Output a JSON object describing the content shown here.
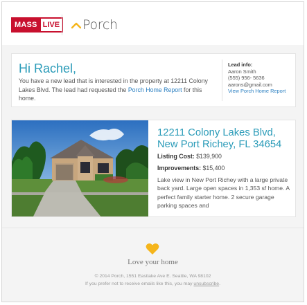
{
  "header": {
    "brand_left_1": "MASS",
    "brand_left_2": "LIVE",
    "brand_right": "Porch",
    "colors": {
      "masslive_red": "#c8102e",
      "porch_yellow": "#f5b51b"
    }
  },
  "intro": {
    "greeting": "Hi Rachel,",
    "text_before_link": "You have a new lead that is interested in the property at 12211 Colony Lakes Blvd. The lead had requested the ",
    "link_text": "Porch Home Report",
    "text_after_link": " for this home.",
    "accent_color": "#2a9bb8"
  },
  "lead": {
    "label": "Lead info:",
    "name": "Aaron Smith",
    "phone": "(555) 956- 5636",
    "email": "aarons@gmail.com",
    "report_link": "View Porch Home Report"
  },
  "property": {
    "address": "12211 Colony Lakes Blvd, New Port Richey, FL 34654",
    "listing_label": "Listing Cost:",
    "listing_value": "$139,900",
    "improvements_label": "Improvements:",
    "improvements_value": "$15,400",
    "description": "Lake view in New Port Richey with a large private back yard. Large open spaces in 1,353 sf home. A perfect family starter home. 2 secure garage parking spaces and"
  },
  "footer": {
    "tagline": "Love your home",
    "copyright": "© 2014 Porch, 1551 Eastlake Ave E. Seattle, WA 98102",
    "unsub_text": "If you prefer not to receive emails like this, you may ",
    "unsub_link": "unsubscribe",
    "unsub_end": "."
  }
}
